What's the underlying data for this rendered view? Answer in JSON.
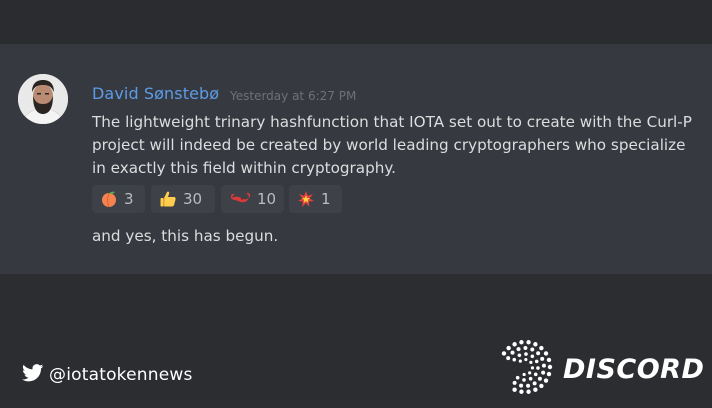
{
  "message": {
    "author": "David Sønstebø",
    "timestamp": "Yesterday at 6:27 PM",
    "text": "The lightweight trinary hashfunction that IOTA set out to create with the Curl-P project will indeed be created by world leading cryptographers who specialize in exactly this field within cryptography.",
    "reactions": [
      {
        "icon": "peach-icon",
        "count": "3"
      },
      {
        "icon": "thumbs-up-icon",
        "count": "30"
      },
      {
        "icon": "lobster-icon",
        "count": "10"
      },
      {
        "icon": "collision-icon",
        "count": "1"
      }
    ],
    "followup": "and yes, this has begun."
  },
  "footer": {
    "twitter_handle": "@iotatokennews",
    "brand_name": "DISCORD"
  },
  "colors": {
    "background": "#2b2d31",
    "card": "#36393f",
    "author_name": "#5c9ce6",
    "text": "#dcddde",
    "timestamp": "#6e7277",
    "reaction_bg": "#3e4147"
  }
}
